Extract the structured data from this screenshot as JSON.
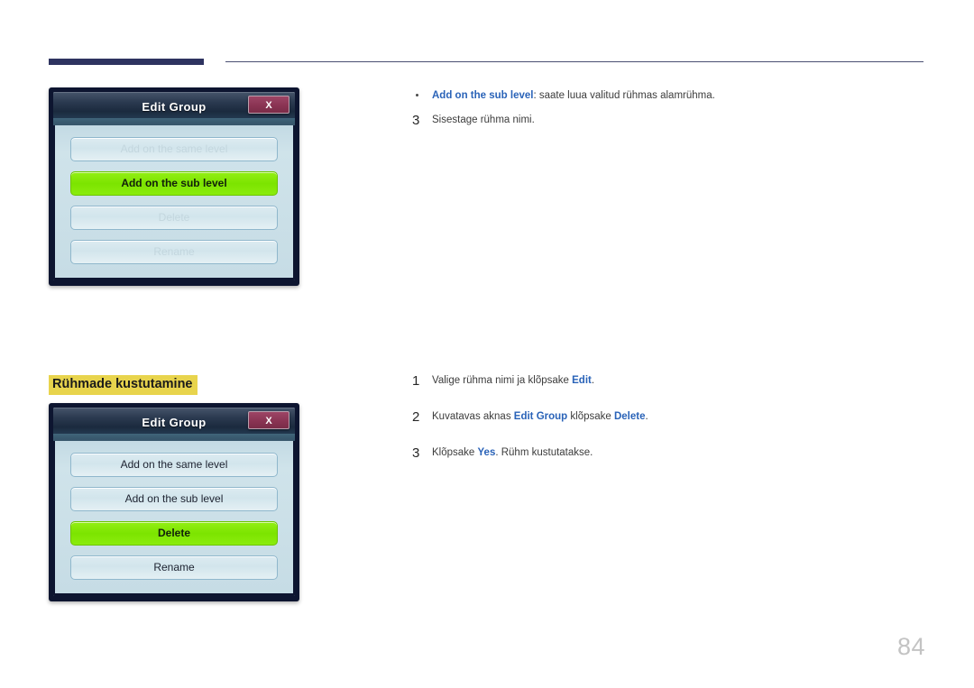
{
  "page": {
    "number": "84"
  },
  "section": {
    "heading": "Rühmade kustutamine"
  },
  "colors": {
    "accent_blue": "#2a63b8",
    "highlight_yellow": "#e8d44d",
    "selected_green": "#7ce400",
    "close_button": "#8a3453",
    "titlebar_dark": "#1b2a3e",
    "rule_navy": "#2e3360",
    "page_number_gray": "#c3c3c3"
  },
  "dialogs": [
    {
      "id": "edit-group-sub-level",
      "title": "Edit Group",
      "close_label": "X",
      "options": [
        {
          "label": "Add on the same level",
          "state": "disabled"
        },
        {
          "label": "Add on the sub level",
          "state": "selected"
        },
        {
          "label": "Delete",
          "state": "disabled"
        },
        {
          "label": "Rename",
          "state": "disabled"
        }
      ]
    },
    {
      "id": "edit-group-delete",
      "title": "Edit Group",
      "close_label": "X",
      "options": [
        {
          "label": "Add on the same level",
          "state": "enabled"
        },
        {
          "label": "Add on the sub level",
          "state": "enabled"
        },
        {
          "label": "Delete",
          "state": "selected"
        },
        {
          "label": "Rename",
          "state": "enabled"
        }
      ]
    }
  ],
  "top_content": {
    "bullet": {
      "keyword": "Add on the sub level",
      "text": ": saate luua valitud rühmas alamrühma."
    },
    "step": {
      "number": "3",
      "text": "Sisestage rühma nimi."
    }
  },
  "delete_steps": [
    {
      "number": "1",
      "parts": [
        {
          "type": "text",
          "value": "Valige rühma nimi ja klõpsake "
        },
        {
          "type": "kw",
          "value": "Edit"
        },
        {
          "type": "text",
          "value": "."
        }
      ]
    },
    {
      "number": "2",
      "parts": [
        {
          "type": "text",
          "value": "Kuvatavas aknas "
        },
        {
          "type": "kw",
          "value": "Edit Group"
        },
        {
          "type": "text",
          "value": " klõpsake "
        },
        {
          "type": "kw",
          "value": "Delete"
        },
        {
          "type": "text",
          "value": "."
        }
      ]
    },
    {
      "number": "3",
      "parts": [
        {
          "type": "text",
          "value": "Klõpsake "
        },
        {
          "type": "kw",
          "value": "Yes"
        },
        {
          "type": "text",
          "value": ". Rühm kustutatakse."
        }
      ]
    }
  ]
}
